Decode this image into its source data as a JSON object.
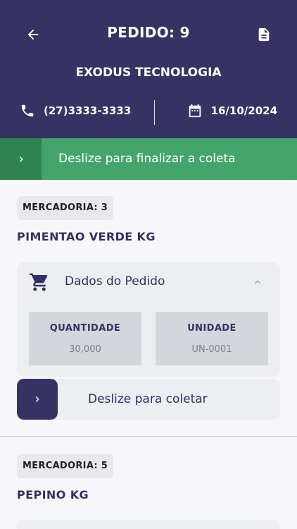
{
  "header": {
    "back_icon": "arrow-left-icon",
    "title": "PEDIDO: 9",
    "doc_icon": "document-icon",
    "company": "EXODUS TECNOLOGIA",
    "phone_icon": "phone-icon",
    "phone": "(27)3333-3333",
    "calendar_icon": "calendar-icon",
    "date": "16/10/2024"
  },
  "finish_slider": {
    "icon": "chevron-right-icon",
    "label": "Deslize para finalizar a coleta"
  },
  "items": [
    {
      "badge": "MERCADORIA: 3",
      "product": "PIMENTAO VERDE KG",
      "details_title": "Dados do Pedido",
      "cart_icon": "cart-icon",
      "toggle_icon": "chevron-up-icon",
      "quantity_label": "QUANTIDADE",
      "quantity_value": "30,000",
      "unit_label": "UNIDADE",
      "unit_value": "UN-0001",
      "collect_label": "Deslize para coletar"
    },
    {
      "badge": "MERCADORIA: 5",
      "product": "PEPINO KG"
    }
  ],
  "colors": {
    "header_bg": "#373264",
    "finish_bg": "#44a56a",
    "finish_handle": "#2e8350",
    "card_bg": "#eceef2",
    "cell_bg": "#d3d7dc",
    "text_primary": "#343063"
  }
}
